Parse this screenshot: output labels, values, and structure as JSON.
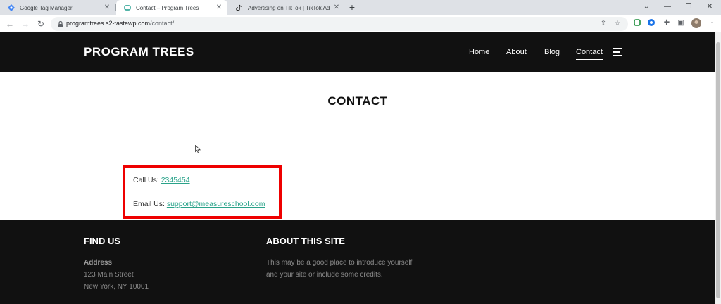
{
  "browser": {
    "tabs": [
      {
        "title": "Google Tag Manager",
        "active": false
      },
      {
        "title": "Contact – Program Trees",
        "active": true
      },
      {
        "title": "Advertising on TikTok | TikTok Ad",
        "active": false
      }
    ],
    "url_host": "programtrees.s2-tastewp.com",
    "url_path": "/contact/"
  },
  "site": {
    "brand": "PROGRAM TREES",
    "nav": [
      "Home",
      "About",
      "Blog",
      "Contact"
    ]
  },
  "main": {
    "title": "CONTACT",
    "call_label": "Call Us: ",
    "call_value": "2345454",
    "email_label": "Email Us: ",
    "email_value": "support@measureschool.com",
    "highlight_color": "#e00000"
  },
  "footer": {
    "find_us_title": "FIND US",
    "address_label": "Address",
    "address_line1": "123 Main Street",
    "address_line2": "New York, NY 10001",
    "about_title": "ABOUT THIS SITE",
    "about_line1": "This may be a good place to introduce yourself",
    "about_line2": "and your site or include some credits."
  },
  "colors": {
    "header_bg": "#111111",
    "link_color": "#2aa38a"
  }
}
